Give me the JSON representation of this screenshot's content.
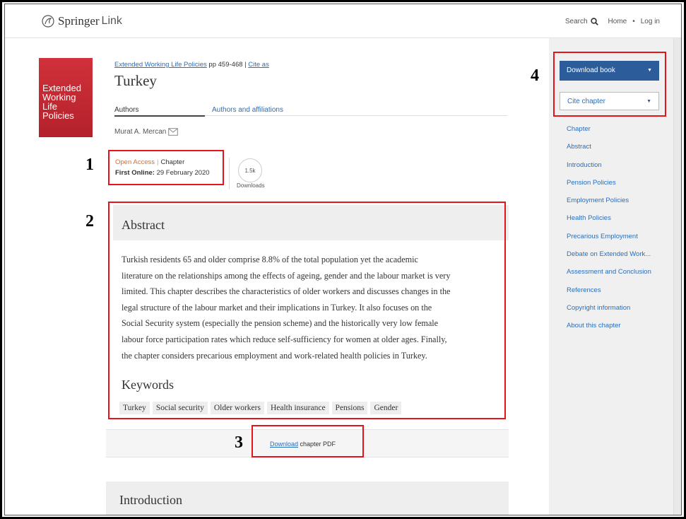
{
  "header": {
    "logo_springer": "Springer",
    "logo_link": "Link",
    "nav_search": "Search",
    "nav_home": "Home",
    "nav_sep": "•",
    "nav_login": "Log in"
  },
  "book_cover": {
    "title_line1": "Extended",
    "title_line2": "Working",
    "title_line3": "Life Policies"
  },
  "breadcrumb": {
    "book_link": "Extended Working Life Policies",
    "pages": " pp 459-468 | ",
    "cite_link": "Cite as"
  },
  "chapter_title": "Turkey",
  "tabs": {
    "authors": "Authors",
    "affiliations": "Authors and affiliations"
  },
  "author_name": "Murat A. Mercan",
  "meta": {
    "open_access": "Open Access",
    "pipe": "|",
    "type": "Chapter",
    "first_online_label": "First Online:",
    "first_online_date": " 29 February 2020",
    "downloads_count": "1.5k",
    "downloads_label": "Downloads"
  },
  "abstract": {
    "heading": "Abstract",
    "line1": "Turkish residents 65 and older comprise 8.8% of the total population yet the academic",
    "line2": "literature on the relationships among the effects of ageing, gender and the labour market is very",
    "line3": "limited. This chapter describes the characteristics of older workers and discusses changes in the",
    "line4": "legal structure of the labour market and their implications in Turkey. It also focuses on the",
    "line5": "Social Security system (especially the pension scheme) and the historically very low female",
    "line6": "labour force participation rates which reduce self-sufficiency for women at older ages. Finally,",
    "line7": "the chapter considers precarious employment and work-related health policies in Turkey."
  },
  "keywords": {
    "heading": "Keywords",
    "items": [
      "Turkey",
      "Social security",
      "Older workers",
      "Health insurance",
      "Pensions",
      "Gender"
    ]
  },
  "pdf": {
    "link": "Download",
    "rest": " chapter PDF"
  },
  "introduction_heading": "Introduction",
  "sidebar": {
    "download_book": "Download book",
    "cite_chapter": "Cite chapter",
    "caret": "▼",
    "toc": [
      "Chapter",
      "Abstract",
      "Introduction",
      "Pension Policies",
      "Employment Policies",
      "Health Policies",
      "Precarious Employment",
      "Debate on Extended Work...",
      "Assessment and Conclusion",
      "References",
      "Copyright information",
      "About this chapter"
    ]
  },
  "annotations": {
    "n1": "1",
    "n2": "2",
    "n3": "3",
    "n4": "4"
  },
  "colors": {
    "link": "#2a6ebb",
    "open_access": "#e26b2a",
    "primary_button": "#2d5c9b",
    "annotation_red": "#e3141b",
    "cover_red": "#c62a33"
  }
}
